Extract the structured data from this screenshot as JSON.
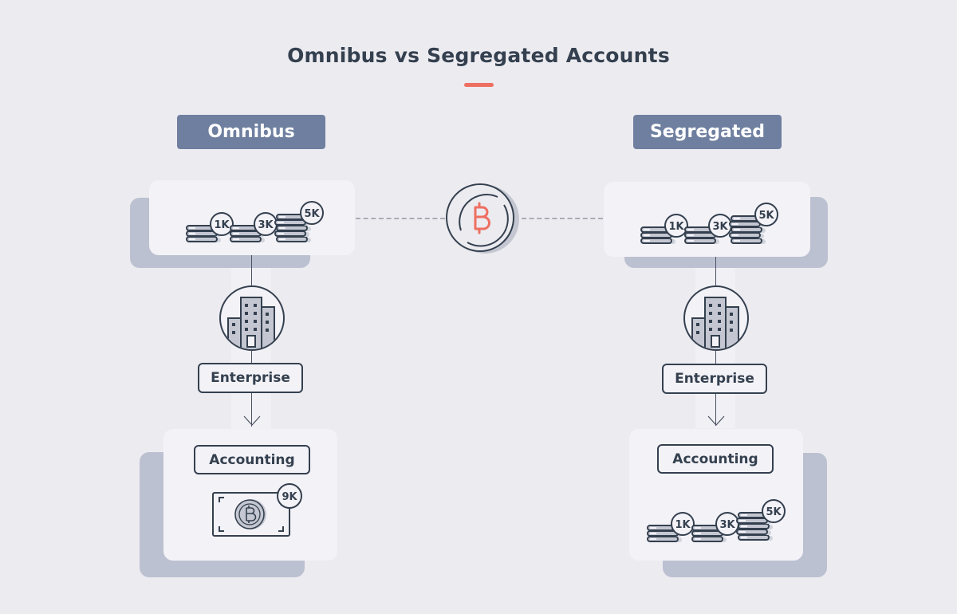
{
  "title": "Omnibus vs Segregated Accounts",
  "colors": {
    "background": "#ecebf0",
    "header_pill": "#6e7fa0",
    "accent": "#ee6f61",
    "card": "#f3f2f7",
    "card_shadow": "#bcc1d1",
    "outline": "#34404f"
  },
  "center_icon": "bitcoin-coin-icon",
  "omnibus": {
    "header": "Omnibus",
    "deposits": [
      {
        "label": "1K",
        "icon": "coin-stack-icon"
      },
      {
        "label": "3K",
        "icon": "coin-stack-icon"
      },
      {
        "label": "5K",
        "icon": "coin-stack-icon"
      }
    ],
    "enterprise_icon": "building-icon",
    "enterprise_label": "Enterprise",
    "accounting_label": "Accounting",
    "accounting_items": [
      {
        "label": "9K",
        "icon": "bitcoin-banknote-icon"
      }
    ]
  },
  "segregated": {
    "header": "Segregated",
    "deposits": [
      {
        "label": "1K",
        "icon": "coin-stack-icon"
      },
      {
        "label": "3K",
        "icon": "coin-stack-icon"
      },
      {
        "label": "5K",
        "icon": "coin-stack-icon"
      }
    ],
    "enterprise_icon": "building-icon",
    "enterprise_label": "Enterprise",
    "accounting_label": "Accounting",
    "accounting_items": [
      {
        "label": "1K",
        "icon": "coin-stack-icon"
      },
      {
        "label": "3K",
        "icon": "coin-stack-icon"
      },
      {
        "label": "5K",
        "icon": "coin-stack-icon"
      }
    ]
  }
}
